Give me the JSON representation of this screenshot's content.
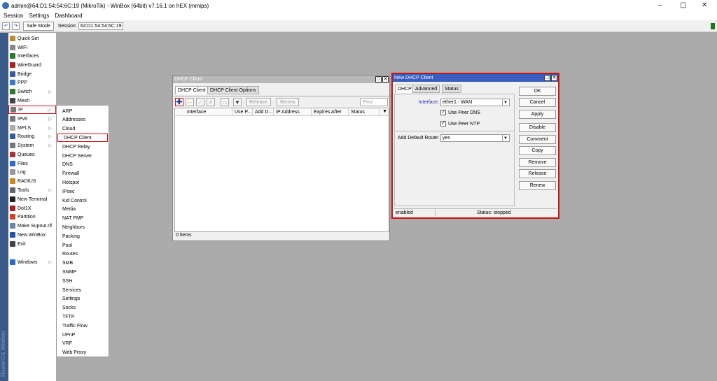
{
  "app": {
    "title": "admin@64:D1:54:54:6C:19 (MikroTik) - WinBox (64bit) v7.16.1 on hEX (mmips)",
    "brand": "RouterOS WinBox"
  },
  "window_controls": {
    "minimize": "–",
    "restore": "▢",
    "close": "✕"
  },
  "menubar": {
    "items": [
      "Session",
      "Settings",
      "Dashboard"
    ]
  },
  "toolbar": {
    "undo": "↶",
    "redo": "↷",
    "safe_mode": "Safe Mode",
    "session_label": "Session:",
    "session_value": "64:D1:54:54:6C:19"
  },
  "sidebar": {
    "items": [
      {
        "label": "Quick Set",
        "icon": "wand-icon",
        "color": "#c08a2a",
        "arrow": false
      },
      {
        "label": "WiFi",
        "icon": "wifi-icon",
        "color": "#888888",
        "arrow": false
      },
      {
        "label": "Interfaces",
        "icon": "interfaces-icon",
        "color": "#2a7a2a",
        "arrow": false
      },
      {
        "label": "WireGuard",
        "icon": "wireguard-icon",
        "color": "#aa2222",
        "arrow": false
      },
      {
        "label": "Bridge",
        "icon": "bridge-icon",
        "color": "#3a5aa0",
        "arrow": false
      },
      {
        "label": "PPP",
        "icon": "ppp-icon",
        "color": "#3a7acc",
        "arrow": false
      },
      {
        "label": "Switch",
        "icon": "switch-icon",
        "color": "#2a7a2a",
        "arrow": true
      },
      {
        "label": "Mesh",
        "icon": "mesh-icon",
        "color": "#444444",
        "arrow": false
      },
      {
        "label": "IP",
        "icon": "ip-icon",
        "color": "#777777",
        "arrow": true
      },
      {
        "label": "IPv6",
        "icon": "ipv6-icon",
        "color": "#777777",
        "arrow": true
      },
      {
        "label": "MPLS",
        "icon": "mpls-icon",
        "color": "#aaaaaa",
        "arrow": true
      },
      {
        "label": "Routing",
        "icon": "routing-icon",
        "color": "#3a5aa0",
        "arrow": true
      },
      {
        "label": "System",
        "icon": "system-icon",
        "color": "#777777",
        "arrow": true
      },
      {
        "label": "Queues",
        "icon": "queues-icon",
        "color": "#aa3333",
        "arrow": false
      },
      {
        "label": "Files",
        "icon": "files-icon",
        "color": "#2a6acc",
        "arrow": false
      },
      {
        "label": "Log",
        "icon": "log-icon",
        "color": "#999999",
        "arrow": false
      },
      {
        "label": "RADIUS",
        "icon": "radius-icon",
        "color": "#cc8822",
        "arrow": false
      },
      {
        "label": "Tools",
        "icon": "tools-icon",
        "color": "#666666",
        "arrow": true
      },
      {
        "label": "New Terminal",
        "icon": "terminal-icon",
        "color": "#222222",
        "arrow": false
      },
      {
        "label": "Dot1X",
        "icon": "dot1x-icon",
        "color": "#aa2222",
        "arrow": false
      },
      {
        "label": "Partition",
        "icon": "partition-icon",
        "color": "#cc4422",
        "arrow": false
      },
      {
        "label": "Make Supout.rif",
        "icon": "supout-icon",
        "color": "#6688aa",
        "arrow": false
      },
      {
        "label": "New WinBox",
        "icon": "winbox-icon",
        "color": "#2255aa",
        "arrow": false
      },
      {
        "label": "Exit",
        "icon": "exit-icon",
        "color": "#444444",
        "arrow": false
      },
      {
        "label": "Windows",
        "icon": "windows-icon",
        "color": "#2a6acc",
        "arrow": true
      }
    ]
  },
  "submenu": {
    "items": [
      "ARP",
      "Addresses",
      "Cloud",
      "DHCP Client",
      "DHCP Relay",
      "DHCP Server",
      "DNS",
      "Firewall",
      "Hotspot",
      "IPsec",
      "Kid Control",
      "Media",
      "NAT PMP",
      "Neighbors",
      "Packing",
      "Pool",
      "Routes",
      "SMB",
      "SNMP",
      "SSH",
      "Services",
      "Settings",
      "Socks",
      "TFTP",
      "Traffic Flow",
      "UPnP",
      "VRF",
      "Web Proxy"
    ]
  },
  "dhcp_client": {
    "title": "DHCP Client",
    "tabs": [
      "DHCP Client",
      "DHCP Client Options"
    ],
    "release": "Release",
    "renew": "Renew",
    "find": "Find",
    "columns": [
      "Interface",
      "Use P...",
      "Add D...",
      "IP Address",
      "Expires After",
      "Status"
    ],
    "count": "0 items"
  },
  "new_dhcp": {
    "title": "New DHCP Client",
    "tabs": [
      "DHCP",
      "Advanced",
      "Status"
    ],
    "interface_label": "Interface:",
    "interface_value": "ether1 - WAN",
    "use_peer_dns": "Use Peer DNS",
    "use_peer_ntp": "Use Peer NTP",
    "default_route_label": "Add Default Route:",
    "default_route_value": "yes",
    "buttons": [
      "OK",
      "Cancel",
      "Apply",
      "Disable",
      "Comment",
      "Copy",
      "Remove",
      "Release",
      "Renew"
    ],
    "status_left": "enabled",
    "status_right": "Status: stopped"
  },
  "colors": {
    "highlight": "#cc1111",
    "add_button": "#1a3a9a",
    "label_blue": "#2233aa"
  }
}
